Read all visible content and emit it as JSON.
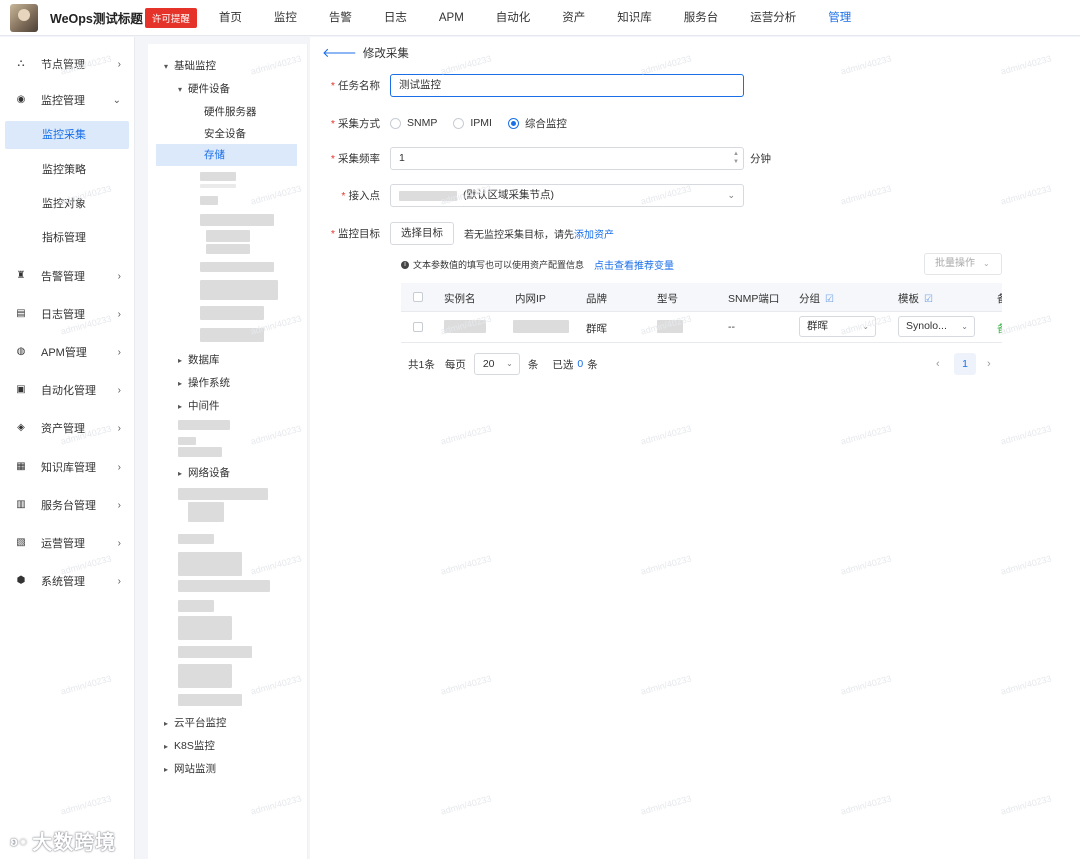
{
  "header": {
    "brand": "WeOps测试标题",
    "license_badge": "许可提醒",
    "nav": [
      "首页",
      "监控",
      "告警",
      "日志",
      "APM",
      "自动化",
      "资产",
      "知识库",
      "服务台",
      "运营分析",
      "管理"
    ],
    "active_nav": "管理"
  },
  "sidebar": {
    "items": [
      {
        "label": "节点管理",
        "icon": "nodes-icon",
        "glyph": "⛬"
      },
      {
        "label": "监控管理",
        "icon": "monitor-icon",
        "glyph": "◉"
      },
      {
        "label": "告警管理",
        "icon": "alarm-icon",
        "glyph": "♜"
      },
      {
        "label": "日志管理",
        "icon": "log-icon",
        "glyph": "▤"
      },
      {
        "label": "APM管理",
        "icon": "apm-icon",
        "glyph": "◍"
      },
      {
        "label": "自动化管理",
        "icon": "automation-icon",
        "glyph": "▣"
      },
      {
        "label": "资产管理",
        "icon": "asset-icon",
        "glyph": "◈"
      },
      {
        "label": "知识库管理",
        "icon": "knowledge-icon",
        "glyph": "▦"
      },
      {
        "label": "服务台管理",
        "icon": "service-desk-icon",
        "glyph": "▥"
      },
      {
        "label": "运营管理",
        "icon": "operation-icon",
        "glyph": "▧"
      },
      {
        "label": "系统管理",
        "icon": "system-icon",
        "glyph": "⬢"
      }
    ],
    "monitor_sub": [
      "监控采集",
      "监控策略",
      "监控对象",
      "指标管理"
    ],
    "active_sub": "监控采集"
  },
  "tree": {
    "root": "基础监控",
    "hardware": "硬件设备",
    "hardware_children": [
      "硬件服务器",
      "安全设备",
      "存储"
    ],
    "others": [
      "数据库",
      "操作系统",
      "中间件"
    ],
    "network": "网络设备",
    "bottom": [
      "云平台监控",
      "K8S监控",
      "网站监测"
    ]
  },
  "form": {
    "back_label": "修改采集",
    "task_name_label": "任务名称",
    "task_name_value": "测试监控",
    "method_label": "采集方式",
    "methods": [
      "SNMP",
      "IPMI",
      "综合监控"
    ],
    "selected_method": "综合监控",
    "frequency_label": "采集频率",
    "frequency_value": "1",
    "frequency_unit": "分钟",
    "access_label": "接入点",
    "access_value": "(默认区域采集节点)",
    "target_label": "监控目标",
    "target_button": "选择目标",
    "target_hint": "若无监控采集目标，请先",
    "target_link": "添加资产",
    "tip_text": "文本参数值的填写也可以使用资产配置信息",
    "tip_link": "点击查看推荐变量",
    "batch_label": "批量操作"
  },
  "table": {
    "columns": [
      "实例名",
      "内网IP",
      "品牌",
      "型号",
      "SNMP端口",
      "分组",
      "模板",
      "备"
    ],
    "rows": [
      {
        "brand": "群晖",
        "snmp_port": "--",
        "group": "群晖",
        "template": "Synolo...",
        "status": "备"
      }
    ]
  },
  "pagination": {
    "total": "共1条",
    "per_page_label": "每页",
    "per_page": "20",
    "per_page_unit": "条",
    "selected_label": "已选",
    "selected_count": "0",
    "selected_unit": "条",
    "current_page": "1"
  },
  "watermark": "admin/40233",
  "footer_logo": "大数跨境"
}
